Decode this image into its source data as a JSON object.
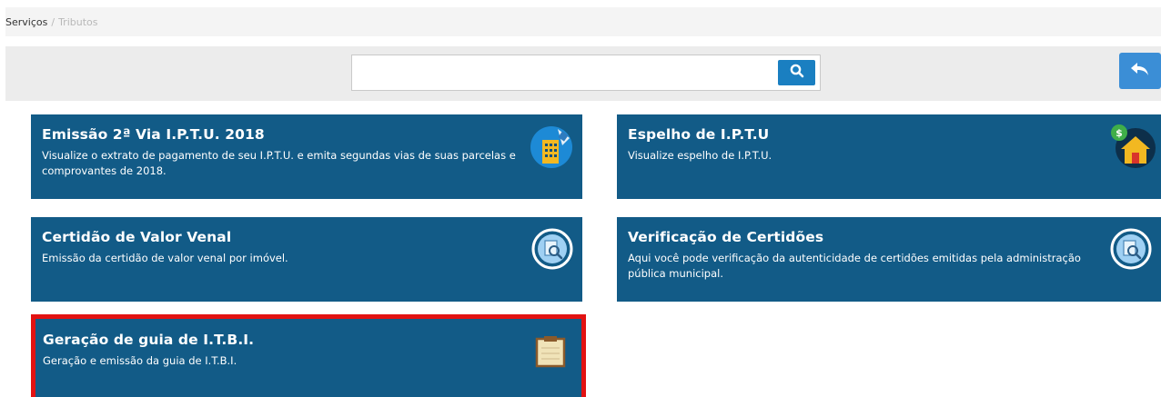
{
  "breadcrumb": {
    "current": "Serviços",
    "separator": "/",
    "last": "Tributos"
  },
  "search": {
    "value": "",
    "placeholder": ""
  },
  "cards": [
    {
      "title": "Emissão 2ª Via I.P.T.U. 2018",
      "desc": "Visualize o extrato de pagamento de seu I.P.T.U. e emita segundas vias de suas parcelas e comprovantes de 2018.",
      "icon": "building-cash-icon"
    },
    {
      "title": "Espelho de I.P.T.U",
      "desc": "Visualize espelho de I.P.T.U.",
      "icon": "house-money-icon"
    },
    {
      "title": "Certidão de Valor Venal",
      "desc": "Emissão da certidão de valor venal por imóvel.",
      "icon": "document-search-icon"
    },
    {
      "title": "Verificação de Certidões",
      "desc": "Aqui você pode verificação da autenticidade de certidões emitidas pela administração pública municipal.",
      "icon": "document-search-icon"
    },
    {
      "title": "Geração de guia de I.T.B.I.",
      "desc": "Geração e emissão da guia de I.T.B.I.",
      "icon": "clipboard-icon",
      "highlighted": true
    }
  ],
  "colors": {
    "card_bg": "#125b87",
    "highlight_border": "#e21212",
    "search_button": "#1a7fc1",
    "back_button": "#3b8ed6"
  }
}
